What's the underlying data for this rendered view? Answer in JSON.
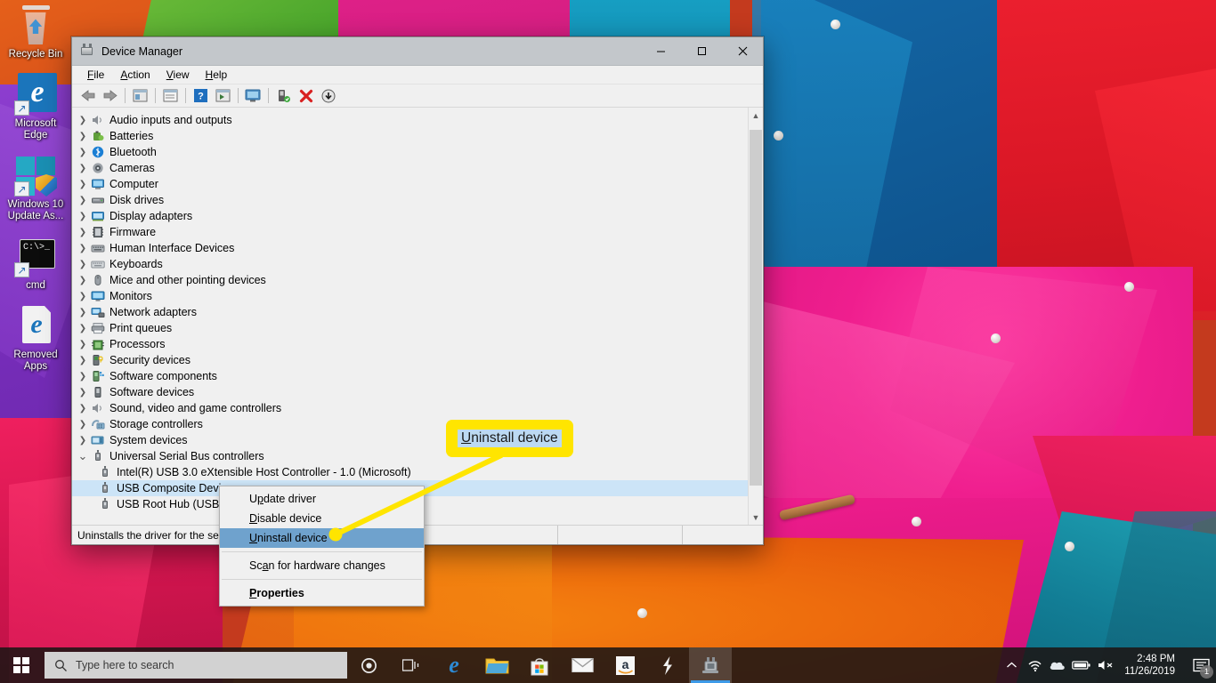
{
  "window": {
    "title": "Device Manager",
    "icon": "device-manager-icon",
    "controls": {
      "minimize": "–",
      "maximize": "□",
      "close": "✕"
    },
    "menubar": [
      {
        "label": "File",
        "accel": "F"
      },
      {
        "label": "Action",
        "accel": "A"
      },
      {
        "label": "View",
        "accel": "V"
      },
      {
        "label": "Help",
        "accel": "H"
      }
    ],
    "toolbar": [
      {
        "name": "back-button",
        "icon": "back-arrow-icon"
      },
      {
        "name": "forward-button",
        "icon": "forward-arrow-icon"
      },
      {
        "name": "show-hide-console-tree-button",
        "icon": "console-tree-icon"
      },
      {
        "name": "properties-button",
        "icon": "properties-icon"
      },
      {
        "name": "help-button",
        "icon": "help-icon"
      },
      {
        "name": "show-hide-action-pane-button",
        "icon": "action-pane-icon"
      },
      {
        "name": "scan-for-hardware-changes-button",
        "icon": "monitor-scan-icon"
      },
      {
        "name": "update-driver-button",
        "icon": "update-driver-icon"
      },
      {
        "name": "uninstall-device-button",
        "icon": "red-x-icon"
      },
      {
        "name": "disable-device-button",
        "icon": "down-arrow-circle-icon"
      }
    ],
    "status": {
      "message": "Uninstalls the driver for the sele",
      "segment2": "",
      "segment3": ""
    }
  },
  "tree": {
    "items": [
      {
        "label": "Audio inputs and outputs",
        "icon": "speaker-icon",
        "expander": "collapsed",
        "level": 0
      },
      {
        "label": "Batteries",
        "icon": "battery-icon",
        "expander": "collapsed",
        "level": 0
      },
      {
        "label": "Bluetooth",
        "icon": "bluetooth-icon",
        "expander": "collapsed",
        "level": 0
      },
      {
        "label": "Cameras",
        "icon": "camera-icon",
        "expander": "collapsed",
        "level": 0
      },
      {
        "label": "Computer",
        "icon": "computer-icon",
        "expander": "collapsed",
        "level": 0
      },
      {
        "label": "Disk drives",
        "icon": "disk-drive-icon",
        "expander": "collapsed",
        "level": 0
      },
      {
        "label": "Display adapters",
        "icon": "display-adapter-icon",
        "expander": "collapsed",
        "level": 0
      },
      {
        "label": "Firmware",
        "icon": "firmware-icon",
        "expander": "collapsed",
        "level": 0
      },
      {
        "label": "Human Interface Devices",
        "icon": "hid-icon",
        "expander": "collapsed",
        "level": 0
      },
      {
        "label": "Keyboards",
        "icon": "keyboard-icon",
        "expander": "collapsed",
        "level": 0
      },
      {
        "label": "Mice and other pointing devices",
        "icon": "mouse-icon",
        "expander": "collapsed",
        "level": 0
      },
      {
        "label": "Monitors",
        "icon": "monitor-icon",
        "expander": "collapsed",
        "level": 0
      },
      {
        "label": "Network adapters",
        "icon": "network-adapter-icon",
        "expander": "collapsed",
        "level": 0
      },
      {
        "label": "Print queues",
        "icon": "printer-icon",
        "expander": "collapsed",
        "level": 0
      },
      {
        "label": "Processors",
        "icon": "processor-icon",
        "expander": "collapsed",
        "level": 0
      },
      {
        "label": "Security devices",
        "icon": "security-device-icon",
        "expander": "collapsed",
        "level": 0
      },
      {
        "label": "Software components",
        "icon": "software-component-icon",
        "expander": "collapsed",
        "level": 0
      },
      {
        "label": "Software devices",
        "icon": "software-device-icon",
        "expander": "collapsed",
        "level": 0
      },
      {
        "label": "Sound, video and game controllers",
        "icon": "speaker-icon",
        "expander": "collapsed",
        "level": 0
      },
      {
        "label": "Storage controllers",
        "icon": "storage-controller-icon",
        "expander": "collapsed",
        "level": 0
      },
      {
        "label": "System devices",
        "icon": "system-device-icon",
        "expander": "collapsed",
        "level": 0
      },
      {
        "label": "Universal Serial Bus controllers",
        "icon": "usb-icon",
        "expander": "expanded",
        "level": 0
      },
      {
        "label": "Intel(R) USB 3.0 eXtensible Host Controller - 1.0 (Microsoft)",
        "icon": "usb-icon",
        "expander": "none",
        "level": 1
      },
      {
        "label": "USB Composite Device",
        "icon": "usb-icon",
        "expander": "none",
        "level": 1,
        "selected": true
      },
      {
        "label": "USB Root Hub (USB 3.0)",
        "icon": "usb-icon",
        "expander": "none",
        "level": 1
      }
    ]
  },
  "context_menu": {
    "items": [
      {
        "label": "Update driver",
        "accel": "p",
        "highlighted": false,
        "bold": false
      },
      {
        "label": "Disable device",
        "accel": "D",
        "highlighted": false,
        "bold": false
      },
      {
        "label": "Uninstall device",
        "accel": "U",
        "highlighted": true,
        "bold": false
      },
      {
        "separator": true
      },
      {
        "label": "Scan for hardware changes",
        "accel": "a",
        "highlighted": false,
        "bold": false
      },
      {
        "separator": true
      },
      {
        "label": "Properties",
        "accel": "P",
        "highlighted": false,
        "bold": true
      }
    ]
  },
  "callout": {
    "text": "Uninstall device",
    "background_color": "#ffe500",
    "text_highlight_color": "#bcd9f2",
    "pointer_color": "#ffe500"
  },
  "desktop_icons": [
    {
      "label": "Recycle Bin",
      "icon": "recycle-bin-icon"
    },
    {
      "label": "Microsoft Edge",
      "icon": "microsoft-edge-icon"
    },
    {
      "label": "Windows 10 Update As...",
      "icon": "windows-update-assistant-icon"
    },
    {
      "label": "cmd",
      "icon": "command-prompt-icon"
    },
    {
      "label": "Removed Apps",
      "icon": "removed-apps-html-icon"
    }
  ],
  "taskbar": {
    "start_button": "start-button",
    "search": {
      "placeholder": "Type here to search",
      "icon": "search-icon"
    },
    "cortana": "cortana-icon",
    "apps": [
      {
        "name": "task-view-button",
        "icon": "task-view-icon"
      },
      {
        "name": "taskbar-edge",
        "icon": "microsoft-edge-icon"
      },
      {
        "name": "taskbar-file-explorer",
        "icon": "file-explorer-icon"
      },
      {
        "name": "taskbar-microsoft-store",
        "icon": "microsoft-store-icon"
      },
      {
        "name": "taskbar-mail",
        "icon": "mail-icon"
      },
      {
        "name": "taskbar-amazon",
        "icon": "amazon-icon"
      },
      {
        "name": "taskbar-lightning",
        "icon": "lightning-bolt-icon"
      },
      {
        "name": "taskbar-device-manager",
        "icon": "device-manager-icon",
        "active": true
      }
    ],
    "tray": [
      {
        "name": "show-hidden-icons-button",
        "icon": "chevron-up-icon"
      },
      {
        "name": "network-icon",
        "icon": "wifi-icon"
      },
      {
        "name": "onedrive-icon",
        "icon": "cloud-icon"
      },
      {
        "name": "battery-icon",
        "icon": "battery-icon"
      },
      {
        "name": "volume-icon",
        "icon": "speaker-muted-icon"
      }
    ],
    "clock": {
      "time": "2:48 PM",
      "date": "11/26/2019"
    },
    "notifications": {
      "icon": "action-center-icon",
      "count": "1"
    }
  }
}
